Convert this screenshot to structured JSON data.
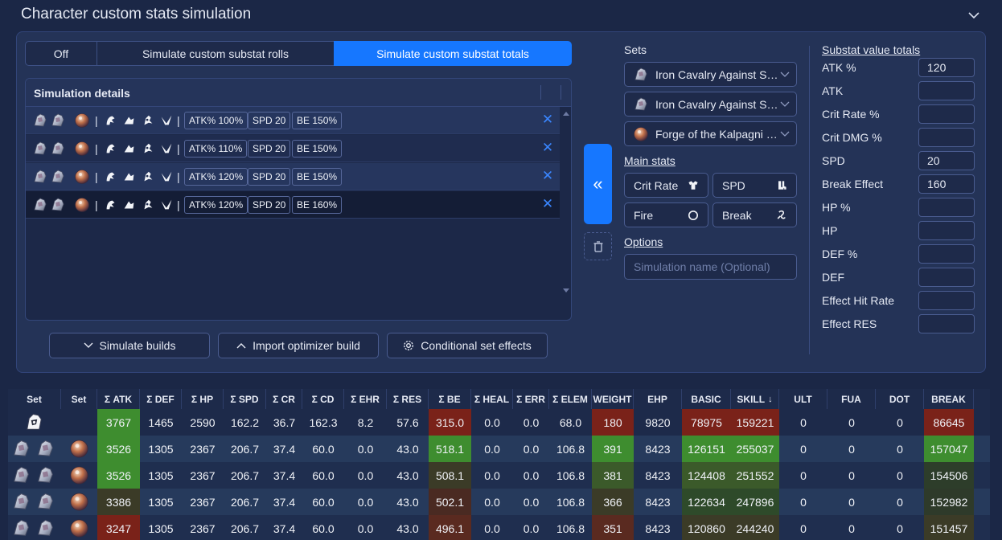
{
  "page": {
    "title": "Character custom stats simulation"
  },
  "modes": [
    {
      "label": "Off",
      "active": false
    },
    {
      "label": "Simulate custom substat rolls",
      "active": false
    },
    {
      "label": "Simulate custom substat totals",
      "active": true
    }
  ],
  "sim": {
    "header": "Simulation details",
    "separator": "|",
    "rows": [
      {
        "tags": [
          "ATK% 100%",
          "SPD 20",
          "BE 150%"
        ]
      },
      {
        "tags": [
          "ATK% 110%",
          "SPD 20",
          "BE 150%"
        ]
      },
      {
        "tags": [
          "ATK% 120%",
          "SPD 20",
          "BE 150%"
        ]
      },
      {
        "tags": [
          "ATK% 120%",
          "SPD 20",
          "BE 160%"
        ]
      }
    ]
  },
  "buttons": {
    "simulate": "Simulate builds",
    "import": "Import optimizer build",
    "conditional": "Conditional set effects",
    "transfer_glyph": "«",
    "remove_glyph": "✕"
  },
  "sets": {
    "label": "Sets",
    "items": [
      "Iron Cavalry Against Scourge",
      "Iron Cavalry Against Scourge",
      "Forge of the Kalpagni Lantern"
    ]
  },
  "main_stats": {
    "label": "Main stats",
    "items": [
      {
        "label": "Crit Rate",
        "icon": "body-armor-icon"
      },
      {
        "label": "SPD",
        "icon": "boots-icon"
      },
      {
        "label": "Fire",
        "icon": "sphere-icon"
      },
      {
        "label": "Break",
        "icon": "rope-icon"
      }
    ]
  },
  "options": {
    "label": "Options",
    "name_placeholder": "Simulation name (Optional)"
  },
  "substats": {
    "label": "Substat value totals",
    "items": [
      {
        "label": "ATK %",
        "value": "120"
      },
      {
        "label": "ATK",
        "value": ""
      },
      {
        "label": "Crit Rate %",
        "value": ""
      },
      {
        "label": "Crit DMG %",
        "value": ""
      },
      {
        "label": "SPD",
        "value": "20"
      },
      {
        "label": "Break Effect",
        "value": "160"
      },
      {
        "label": "HP %",
        "value": ""
      },
      {
        "label": "HP",
        "value": ""
      },
      {
        "label": "DEF %",
        "value": ""
      },
      {
        "label": "DEF",
        "value": ""
      },
      {
        "label": "Effect Hit Rate",
        "value": ""
      },
      {
        "label": "Effect RES",
        "value": ""
      }
    ]
  },
  "grid": {
    "columns": [
      "Set",
      "Set",
      "Σ ATK",
      "Σ DEF",
      "Σ HP",
      "Σ SPD",
      "Σ CR",
      "Σ CD",
      "Σ EHR",
      "Σ RES",
      "Σ BE",
      "Σ HEAL",
      "Σ ERR",
      "Σ ELEM",
      "WEIGHT",
      "EHP",
      "BASIC",
      "SKILL",
      "ULT",
      "FUA",
      "DOT",
      "BREAK"
    ],
    "sort_glyph": "↓",
    "rows": [
      [
        "",
        "",
        "3767",
        "1465",
        "2590",
        "162.2",
        "36.7",
        "162.3",
        "8.2",
        "57.6",
        "315.0",
        "0.0",
        "0.0",
        "68.0",
        "180",
        "9820",
        "78975",
        "159221",
        "0",
        "0",
        "0",
        "86645"
      ],
      [
        "",
        "",
        "3526",
        "1305",
        "2367",
        "206.7",
        "37.4",
        "60.0",
        "0.0",
        "43.0",
        "518.1",
        "0.0",
        "0.0",
        "106.8",
        "391",
        "8423",
        "126151",
        "255037",
        "0",
        "0",
        "0",
        "157047"
      ],
      [
        "",
        "",
        "3526",
        "1305",
        "2367",
        "206.7",
        "37.4",
        "60.0",
        "0.0",
        "43.0",
        "508.1",
        "0.0",
        "0.0",
        "106.8",
        "381",
        "8423",
        "124408",
        "251552",
        "0",
        "0",
        "0",
        "154506"
      ],
      [
        "",
        "",
        "3386",
        "1305",
        "2367",
        "206.7",
        "37.4",
        "60.0",
        "0.0",
        "43.0",
        "502.1",
        "0.0",
        "0.0",
        "106.8",
        "366",
        "8423",
        "122634",
        "247896",
        "0",
        "0",
        "0",
        "152982"
      ],
      [
        "",
        "",
        "3247",
        "1305",
        "2367",
        "206.7",
        "37.4",
        "60.0",
        "0.0",
        "43.0",
        "496.1",
        "0.0",
        "0.0",
        "106.8",
        "351",
        "8423",
        "120860",
        "244240",
        "0",
        "0",
        "0",
        "151457"
      ]
    ],
    "cell_colors": [
      {
        "2": "#3e8d2f",
        "10": "#7a2219",
        "14": "#7a2219",
        "16": "#7a2219",
        "17": "#7a2219",
        "21": "#7a2219"
      },
      {
        "2": "#3e8d2f",
        "10": "#3e8d2f",
        "14": "#3e8d2f",
        "16": "#3e8d2f",
        "17": "#3e8d2f",
        "21": "#3e8d2f"
      },
      {
        "2": "#3e8d2f",
        "10": "#3b3b27",
        "14": "#3b5a2a",
        "16": "#3b5a2a",
        "17": "#3b5a2a",
        "21": "#2d3d2a"
      },
      {
        "2": "#3b3b27",
        "10": "#4a2a22",
        "14": "#3b3b27",
        "16": "#2e4a2a",
        "17": "#2e4a2a",
        "21": "#2e3a2a"
      },
      {
        "2": "#7a2219",
        "10": "#5a2a20",
        "14": "#5a2a20",
        "16": "#3b3b27",
        "17": "#3b3b27",
        "21": "#3b3b27"
      }
    ]
  },
  "colors": {
    "accent": "#1677ff",
    "positive": "#3e8d2f",
    "negative": "#7a2219",
    "link": "#3a86ff"
  }
}
